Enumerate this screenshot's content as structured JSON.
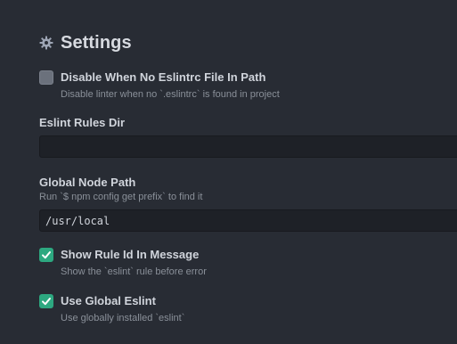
{
  "section": {
    "title": "Settings",
    "icon": "gear-icon"
  },
  "settings": {
    "disable_no_eslintrc": {
      "label": "Disable When No Eslintrc File In Path",
      "description": "Disable linter when no `.eslintrc` is found in project",
      "checked": false
    },
    "eslint_rules_dir": {
      "label": "Eslint Rules Dir",
      "value": ""
    },
    "global_node_path": {
      "label": "Global Node Path",
      "description": "Run `$ npm config get prefix` to find it",
      "value": "/usr/local"
    },
    "show_rule_id": {
      "label": "Show Rule Id In Message",
      "description": "Show the `eslint` rule before error",
      "checked": true
    },
    "use_global_eslint": {
      "label": "Use Global Eslint",
      "description": "Use globally installed `eslint`",
      "checked": true
    }
  },
  "colors": {
    "background": "#282c34",
    "checkbox_on": "#2da880",
    "checkbox_off": "#6b717c",
    "input_bg": "#1e2127"
  }
}
